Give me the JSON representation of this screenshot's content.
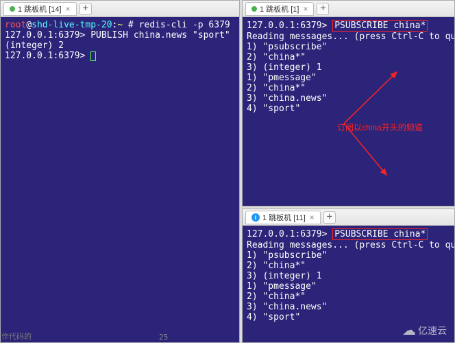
{
  "left": {
    "tab_title": "1 跳板机 [14]",
    "line1_user": "root",
    "line1_at": "@",
    "line1_host": "shd-live-tmp-20",
    "line1_colon": ":",
    "line1_path": "~",
    "line1_cmd": " # redis-cli -p 6379",
    "line2": "127.0.0.1:6379> PUBLISH china.news \"sport\"",
    "line3": "(integer) 2",
    "line4_prompt": "127.0.0.1:6379> "
  },
  "right_top": {
    "tab_title": "1 跳板机 [1]",
    "line1_prompt": "127.0.0.1:6379> ",
    "line1_cmd": "PSUBSCRIBE china*",
    "line2": "Reading messages... (press Ctrl-C to quit)",
    "line3": "1) \"psubscribe\"",
    "line4": "2) \"china*\"",
    "line5": "3) (integer) 1",
    "line6": "1) \"pmessage\"",
    "line7": "2) \"china*\"",
    "line8": "3) \"china.news\"",
    "line9": "4) \"sport\""
  },
  "right_bottom": {
    "tab_title": "1 跳板机 [11]",
    "line1_prompt": "127.0.0.1:6379> ",
    "line1_cmd": "PSUBSCRIBE china*",
    "line2": "Reading messages... (press Ctrl-C to quit)",
    "line3": "1) \"psubscribe\"",
    "line4": "2) \"china*\"",
    "line5": "3) (integer) 1",
    "line6": "1) \"pmessage\"",
    "line7": "2) \"china*\"",
    "line8": "3) \"china.news\"",
    "line9": "4) \"sport\""
  },
  "annotation": "订阅以china开头的频道",
  "watermark": "亿速云",
  "footer_text": "作代码的",
  "footer_num": "25"
}
